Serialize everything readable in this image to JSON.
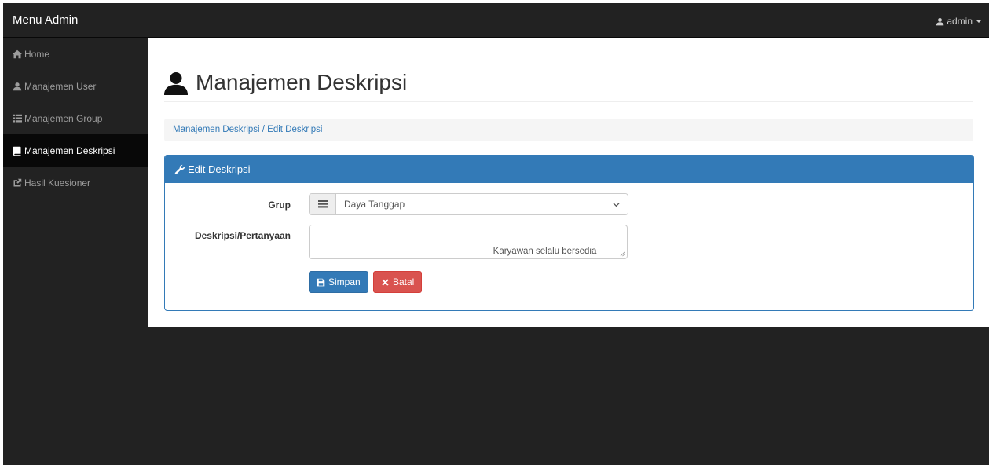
{
  "navbar": {
    "brand": "Menu Admin",
    "user_label": "admin"
  },
  "sidebar": {
    "items": [
      {
        "label": "Home",
        "icon": "home-icon",
        "active": false
      },
      {
        "label": "Manajemen User",
        "icon": "user-icon",
        "active": false
      },
      {
        "label": "Manajemen Group",
        "icon": "list-icon",
        "active": false
      },
      {
        "label": "Manajemen Deskripsi",
        "icon": "book-icon",
        "active": true
      },
      {
        "label": "Hasil Kuesioner",
        "icon": "share-icon",
        "active": false
      }
    ]
  },
  "page": {
    "title": "Manajemen Deskripsi",
    "title_icon": "user-icon"
  },
  "breadcrumb": {
    "path": "Manajemen Deskripsi / Edit Deskripsi"
  },
  "panel": {
    "heading": "Edit Deskripsi",
    "heading_icon": "wrench-icon"
  },
  "form": {
    "group_label": "Grup",
    "group_value": "Daya Tanggap",
    "description_label": "Deskripsi/Pertanyaan",
    "description_value": "                                                              Karyawan selalu bersedia untuk\nmerespon keluhan tamu",
    "save_label": "Simpan",
    "cancel_label": "Batal"
  },
  "colors": {
    "navbar_bg": "#222222",
    "primary": "#337ab7",
    "danger": "#d9534f",
    "breadcrumb_bg": "#f5f5f5"
  }
}
